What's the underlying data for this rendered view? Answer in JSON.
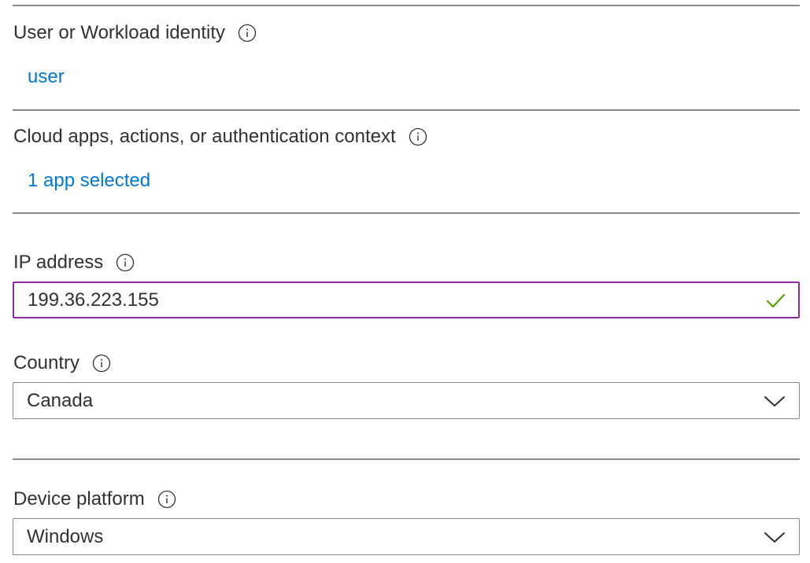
{
  "user_section": {
    "label": "User or Workload identity",
    "link": "user",
    "icon": "info-icon"
  },
  "apps_section": {
    "label": "Cloud apps, actions, or authentication context",
    "link": "1 app selected",
    "icon": "info-icon"
  },
  "ip_section": {
    "label": "IP address",
    "value": "199.36.223.155",
    "valid_icon": "checkmark-icon",
    "icon": "info-icon"
  },
  "country_section": {
    "label": "Country",
    "selected": "Canada",
    "icon": "info-icon",
    "dropdown_icon": "chevron-down-icon"
  },
  "device_section": {
    "label": "Device platform",
    "selected": "Windows",
    "icon": "info-icon",
    "dropdown_icon": "chevron-down-icon"
  },
  "colors": {
    "link": "#0078d4",
    "text": "#323130",
    "border": "#8a8886",
    "focus_border": "#8a2da5",
    "valid": "#57a300"
  }
}
